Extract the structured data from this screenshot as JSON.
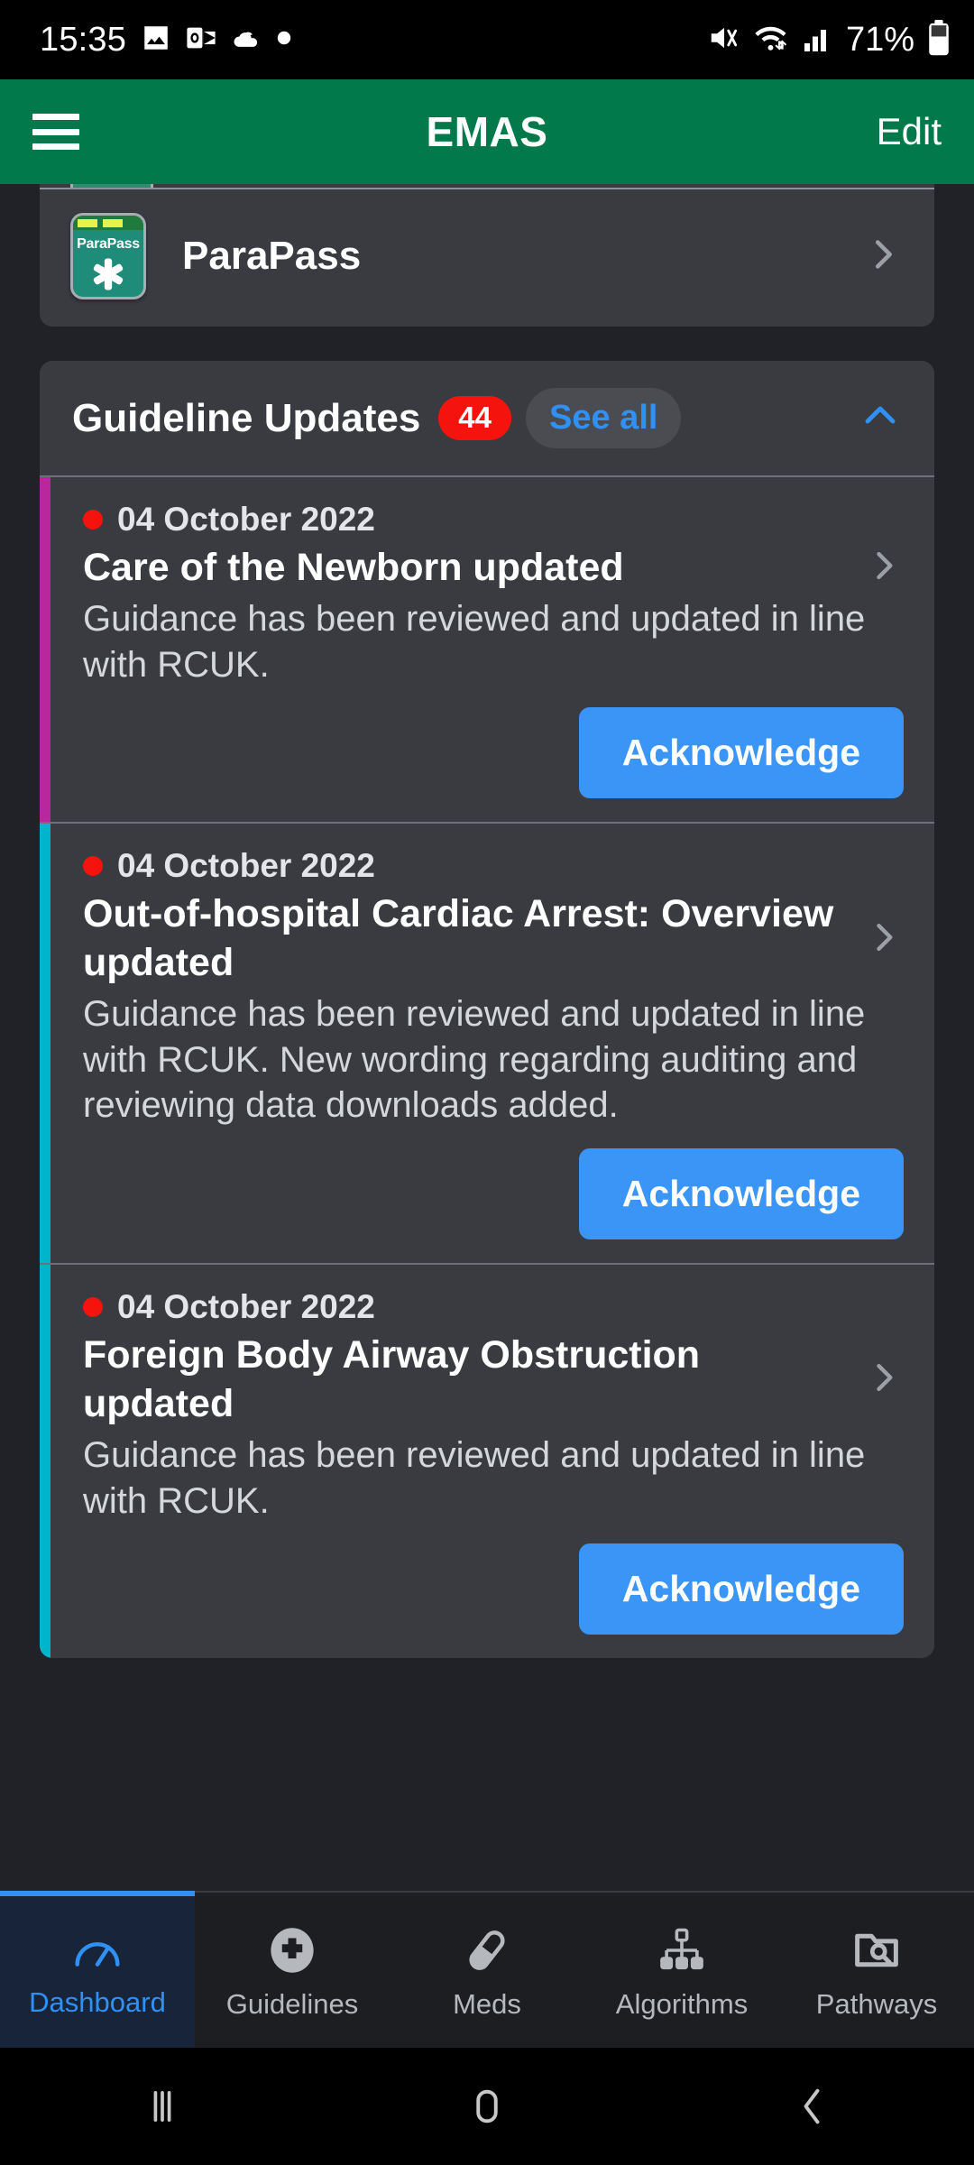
{
  "statusbar": {
    "time": "15:35",
    "battery_percent": "71%",
    "icons": [
      "photos-icon",
      "outlook-icon",
      "weather-cloud-icon",
      "dot-icon",
      "mute-icon",
      "wifi-icon",
      "signal-icon",
      "battery-icon"
    ]
  },
  "appbar": {
    "menu_icon": "hamburger-menu-icon",
    "title": "EMAS",
    "edit_label": "Edit"
  },
  "apps_card": {
    "rows": [
      {
        "label": "ParaPass",
        "icon_text": "ParaPass",
        "icon_name": "parapass-app-icon"
      }
    ]
  },
  "guideline_updates": {
    "title": "Guideline Updates",
    "badge_count": "44",
    "see_all_label": "See all",
    "collapse_icon": "chevron-up-icon",
    "items": [
      {
        "accent_color": "#B9279F",
        "date": "04 October 2022",
        "headline": "Care of the Newborn updated",
        "body": "Guidance has been reviewed and updated in line with RCUK.",
        "ack_label": "Acknowledge"
      },
      {
        "accent_color": "#00B5CB",
        "date": "04 October 2022",
        "headline": "Out-of-hospital Cardiac Arrest: Overview updated",
        "body": "Guidance has been reviewed and updated in line with RCUK. New wording regarding auditing and reviewing data downloads added.",
        "ack_label": "Acknowledge"
      },
      {
        "accent_color": "#00B5CB",
        "date": "04 October 2022",
        "headline": "Foreign Body Airway Obstruction updated",
        "body": "Guidance has been reviewed and updated in line with RCUK.",
        "ack_label": "Acknowledge"
      }
    ]
  },
  "bottom_nav": {
    "active": "Dashboard",
    "items": [
      {
        "label": "Dashboard",
        "icon": "gauge-icon"
      },
      {
        "label": "Guidelines",
        "icon": "medical-cross-circle-icon"
      },
      {
        "label": "Meds",
        "icon": "pill-capsule-icon"
      },
      {
        "label": "Algorithms",
        "icon": "hierarchy-tree-icon"
      },
      {
        "label": "Pathways",
        "icon": "folder-search-icon"
      }
    ]
  },
  "android_nav": {
    "recents_icon": "recent-apps-icon",
    "home_icon": "home-icon",
    "back_icon": "back-icon"
  },
  "colors": {
    "brand_green": "#02794B",
    "accent_blue": "#3A95F7",
    "badge_red": "#F5130D",
    "page_bg": "#212227",
    "card_bg": "#393B41"
  }
}
